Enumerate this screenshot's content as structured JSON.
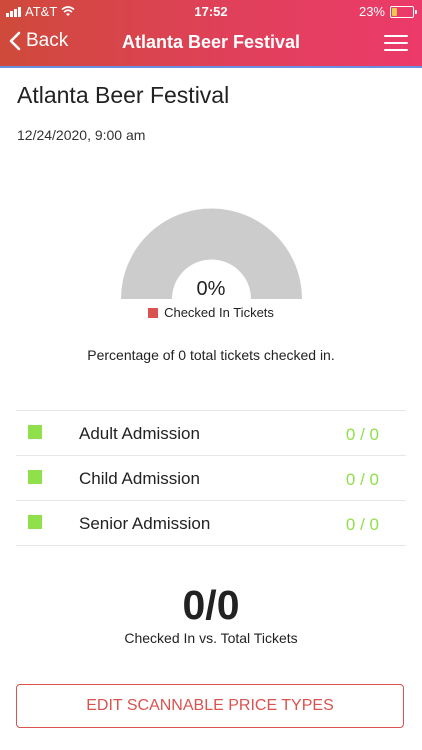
{
  "status_bar": {
    "carrier": "AT&T",
    "time": "17:52",
    "battery_percent": "23%",
    "battery_level": 0.23,
    "battery_color": "#f2c94c"
  },
  "nav": {
    "back_label": "Back",
    "title": "Atlanta Beer Festival",
    "menu_icon": "hamburger-menu-icon"
  },
  "colors": {
    "header_gradient_start": "#cf4a3b",
    "header_gradient_end": "#ec3a6a",
    "accent_red": "#d9534f",
    "accent_green": "#8fe04a",
    "gauge_empty": "#cccccc"
  },
  "event": {
    "title": "Atlanta Beer Festival",
    "datetime": "12/24/2020, 9:00 am"
  },
  "chart_data": {
    "type": "gauge",
    "value_percent": 0,
    "center_label": "0%",
    "legend": [
      {
        "name": "Checked In Tickets",
        "color": "#d9534f"
      }
    ],
    "total_tickets": 0,
    "summary": "Percentage of 0 total tickets checked in."
  },
  "admissions": [
    {
      "label": "Adult Admission",
      "count": "0 / 0"
    },
    {
      "label": "Child Admission",
      "count": "0 / 0"
    },
    {
      "label": "Senior Admission",
      "count": "0 / 0"
    }
  ],
  "totals": {
    "ratio": "0/0",
    "label": "Checked In vs. Total Tickets"
  },
  "actions": {
    "edit_label": "EDIT SCANNABLE PRICE TYPES"
  }
}
